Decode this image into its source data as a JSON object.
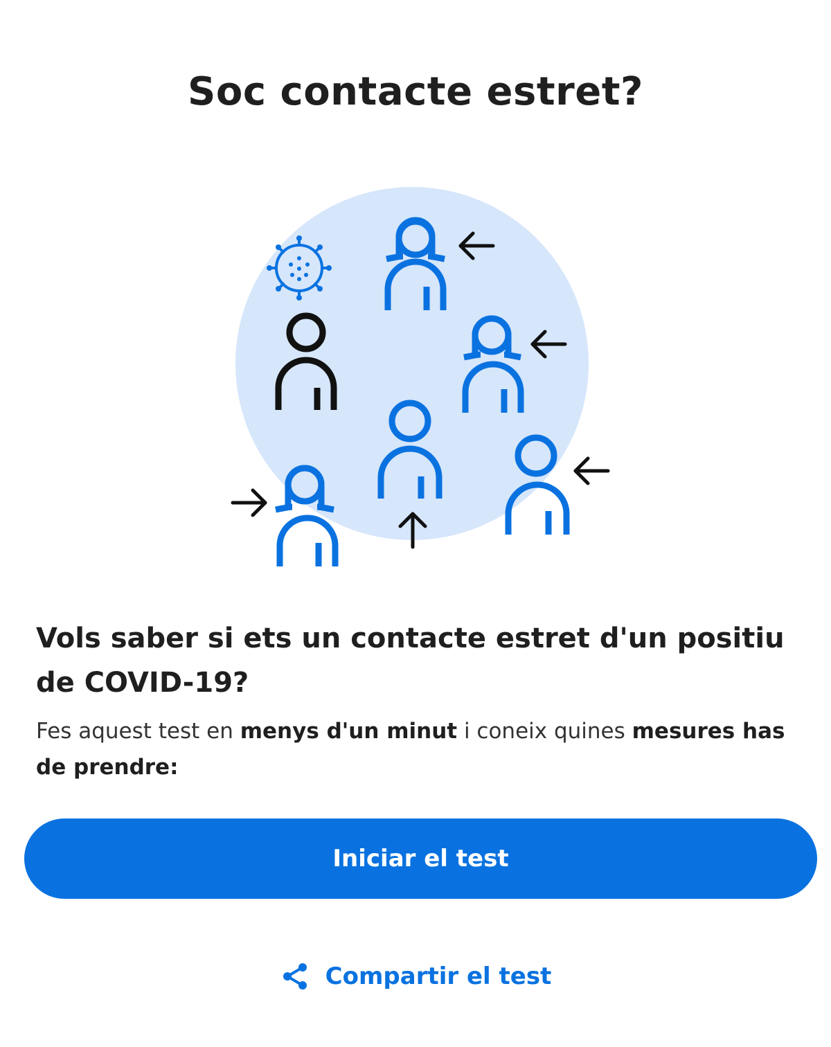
{
  "header": {
    "title": "Soc contacte estret?"
  },
  "illustration": {
    "icon": "close-contacts-illustration",
    "colors": {
      "circle": "#d6e6fb",
      "contacts": "#0a72e0",
      "positive": "#111111",
      "arrows": "#111111"
    }
  },
  "intro": {
    "question": "Vols saber si ets un contacte estret d'un positiu de COVID-19?",
    "desc_part1": "Fes aquest test en ",
    "desc_bold1": "menys d'un minut",
    "desc_part2": " i coneix quines ",
    "desc_bold2": "mesures has de prendre:"
  },
  "actions": {
    "start_label": "Iniciar el test",
    "share_label": "Compartir el test",
    "share_icon": "share-icon"
  },
  "theme": {
    "accent": "#0a72e0",
    "text": "#1f1f1f"
  }
}
